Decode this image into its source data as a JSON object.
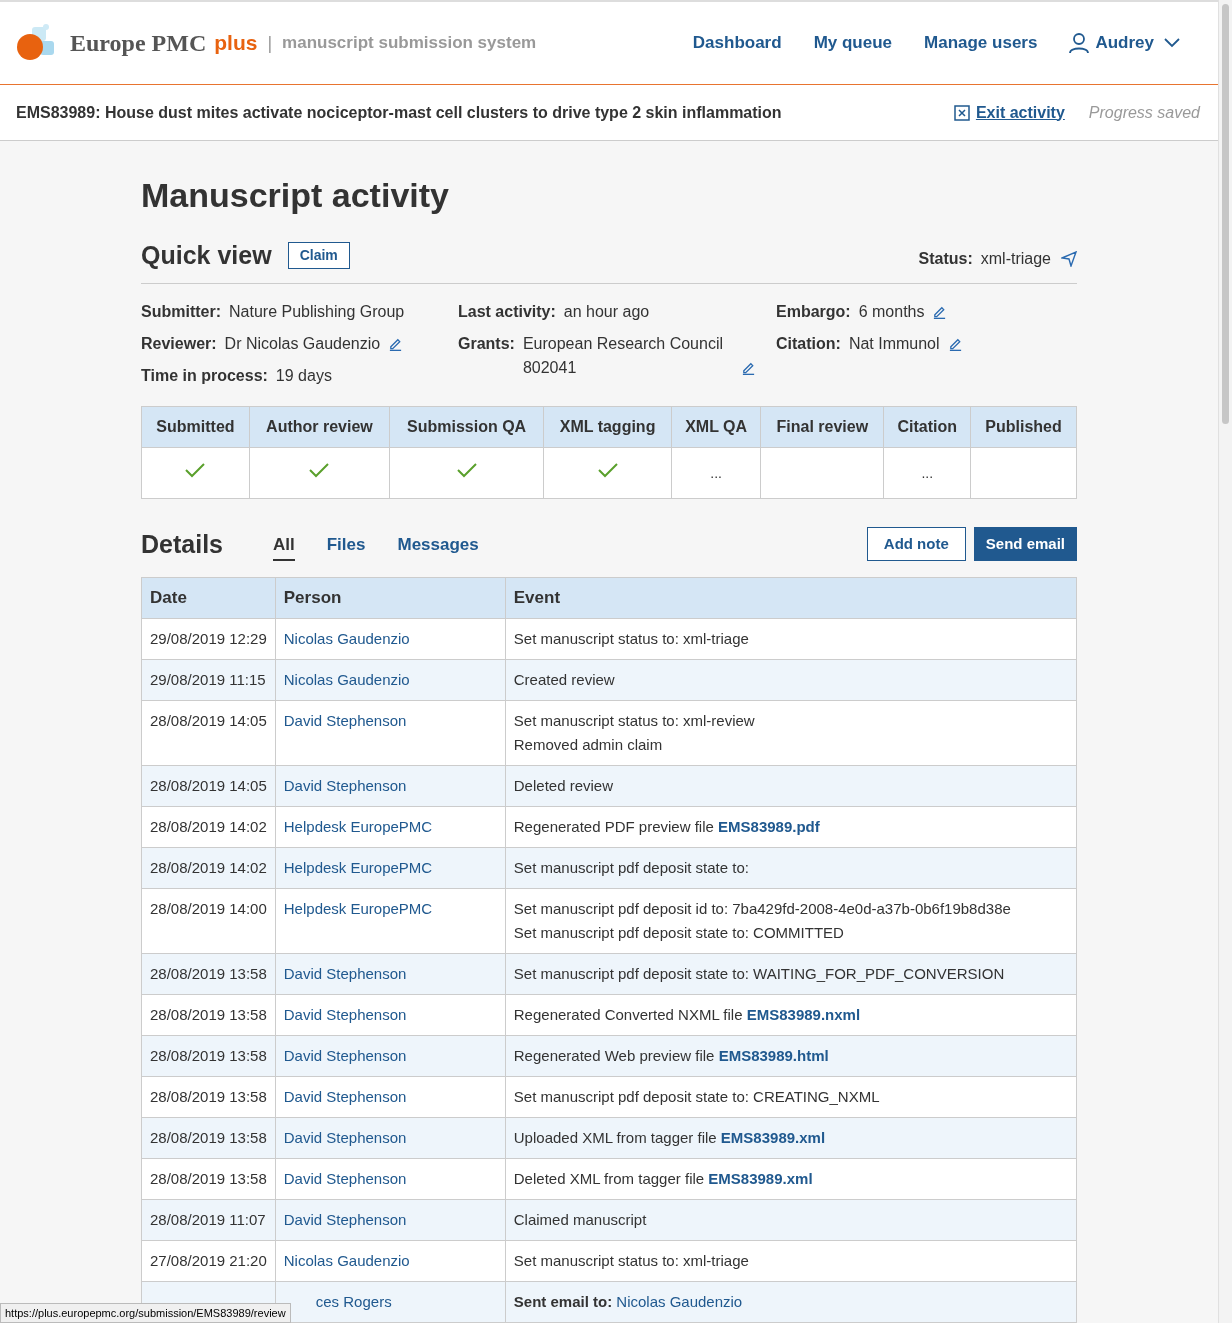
{
  "header": {
    "brand": "Europe PMC",
    "brand_suffix": "plus",
    "separator": "|",
    "tagline": "manuscript submission system",
    "nav": [
      "Dashboard",
      "My queue",
      "Manage users"
    ],
    "user": "Audrey"
  },
  "activity_bar": {
    "title": "EMS83989: House dust mites activate nociceptor-mast cell clusters to drive type 2 skin inflammation",
    "exit": "Exit activity",
    "saved": "Progress saved"
  },
  "page_title": "Manuscript activity",
  "quick_view": {
    "title": "Quick view",
    "claim": "Claim",
    "status_label": "Status:",
    "status": "xml-triage",
    "columns": [
      [
        {
          "label": "Submitter:",
          "value": "Nature Publishing Group",
          "editable": false
        },
        {
          "label": "Reviewer:",
          "value": "Dr Nicolas Gaudenzio",
          "editable": true
        },
        {
          "label": "Time in process:",
          "value": "19 days",
          "editable": false
        }
      ],
      [
        {
          "label": "Last activity:",
          "value": "an hour ago",
          "editable": false
        },
        {
          "label": "Grants:",
          "value": "European Research Council 802041",
          "editable": true
        }
      ],
      [
        {
          "label": "Embargo:",
          "value": "6 months",
          "editable": true
        },
        {
          "label": "Citation:",
          "value": "Nat Immunol",
          "editable": true
        }
      ]
    ],
    "stages": [
      {
        "label": "Submitted",
        "done": true
      },
      {
        "label": "Author review",
        "done": true
      },
      {
        "label": "Submission QA",
        "done": true
      },
      {
        "label": "XML tagging",
        "done": true
      },
      {
        "label": "XML QA",
        "done": false,
        "indicator": "..."
      },
      {
        "label": "Final review",
        "done": false
      },
      {
        "label": "Citation",
        "done": false,
        "indicator": "..."
      },
      {
        "label": "Published",
        "done": false
      }
    ]
  },
  "details": {
    "title": "Details",
    "tabs": [
      {
        "label": "All",
        "selected": true
      },
      {
        "label": "Files",
        "selected": false
      },
      {
        "label": "Messages",
        "selected": false
      }
    ],
    "add_note": "Add note",
    "send_email": "Send email",
    "columns": [
      "Date",
      "Person",
      "Event"
    ],
    "rows": [
      {
        "date": "29/08/2019 12:29",
        "person": "Nicolas Gaudenzio",
        "event": [
          {
            "text": "Set manuscript status to: xml-triage"
          }
        ]
      },
      {
        "date": "29/08/2019 11:15",
        "person": "Nicolas Gaudenzio",
        "event": [
          {
            "text": "Created review"
          }
        ]
      },
      {
        "date": "28/08/2019 14:05",
        "person": "David Stephenson",
        "event": [
          {
            "text": "Set manuscript status to: xml-review"
          },
          {
            "text": "Removed admin claim"
          }
        ]
      },
      {
        "date": "28/08/2019 14:05",
        "person": "David Stephenson",
        "event": [
          {
            "text": "Deleted review"
          }
        ]
      },
      {
        "date": "28/08/2019 14:02",
        "person": "Helpdesk EuropePMC",
        "event": [
          {
            "text": "Regenerated PDF preview file",
            "link": "EMS83989.pdf"
          }
        ]
      },
      {
        "date": "28/08/2019 14:02",
        "person": "Helpdesk EuropePMC",
        "event": [
          {
            "text": "Set manuscript pdf deposit state to:"
          }
        ]
      },
      {
        "date": "28/08/2019 14:00",
        "person": "Helpdesk EuropePMC",
        "event": [
          {
            "text": "Set manuscript pdf deposit id to: 7ba429fd-2008-4e0d-a37b-0b6f19b8d38e"
          },
          {
            "text": "Set manuscript pdf deposit state to: COMMITTED"
          }
        ]
      },
      {
        "date": "28/08/2019 13:58",
        "person": "David Stephenson",
        "event": [
          {
            "text": "Set manuscript pdf deposit state to: WAITING_FOR_PDF_CONVERSION"
          }
        ]
      },
      {
        "date": "28/08/2019 13:58",
        "person": "David Stephenson",
        "event": [
          {
            "text": "Regenerated Converted NXML file",
            "link": "EMS83989.nxml"
          }
        ]
      },
      {
        "date": "28/08/2019 13:58",
        "person": "David Stephenson",
        "event": [
          {
            "text": "Regenerated Web preview file",
            "link": "EMS83989.html"
          }
        ]
      },
      {
        "date": "28/08/2019 13:58",
        "person": "David Stephenson",
        "event": [
          {
            "text": "Set manuscript pdf deposit state to: CREATING_NXML"
          }
        ]
      },
      {
        "date": "28/08/2019 13:58",
        "person": "David Stephenson",
        "event": [
          {
            "text": "Uploaded XML from tagger file",
            "link": "EMS83989.xml"
          }
        ]
      },
      {
        "date": "28/08/2019 13:58",
        "person": "David Stephenson",
        "event": [
          {
            "text": "Deleted XML from tagger file",
            "link": "EMS83989.xml"
          }
        ]
      },
      {
        "date": "28/08/2019 11:07",
        "person": "David Stephenson",
        "event": [
          {
            "text": "Claimed manuscript"
          }
        ]
      },
      {
        "date": "27/08/2019 21:20",
        "person": "Nicolas Gaudenzio",
        "event": [
          {
            "text": "Set manuscript status to: xml-triage"
          }
        ]
      },
      {
        "person": "ces Rogers",
        "event": [
          {
            "text": "Sent email to:",
            "link": "Nicolas Gaudenzio",
            "bold": true
          }
        ]
      }
    ]
  },
  "status_url": "https://plus.europepmc.org/submission/EMS83989/review"
}
